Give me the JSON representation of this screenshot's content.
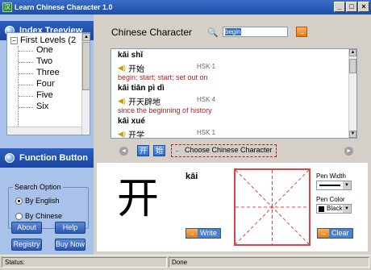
{
  "window": {
    "title": "Learn Chinese Character 1.0",
    "buttons": [
      "_",
      "□",
      "×"
    ]
  },
  "sidebar": {
    "tree_header": "Index Treeview",
    "tree": {
      "root": "First Levels (2",
      "children": [
        "One",
        "Two",
        "Three",
        "Four",
        "Five",
        "Six"
      ]
    },
    "function_header": "Function Button",
    "search_option": {
      "legend": "Search Option",
      "options": [
        {
          "label": "By English",
          "selected": true
        },
        {
          "label": "By Chinese",
          "selected": false
        }
      ]
    },
    "buttons": {
      "about": "About",
      "help": "Help",
      "registry": "Registry",
      "buy_now": "Buy Now"
    }
  },
  "main": {
    "title": "Chinese Character",
    "search_value": "begin",
    "go_label": "→",
    "entries": [
      {
        "pinyin": "kāi shǐ",
        "hanzi": "开始",
        "hsk": "HSK 1",
        "meaning": "begin; start; start; set out on"
      },
      {
        "pinyin": "kāi tiān pì dì",
        "hanzi": "开天辟地",
        "hsk": "HSK 4",
        "meaning": "since the beginning of history"
      },
      {
        "pinyin": "kāi xué",
        "hanzi": "开学",
        "hsk": "HSK 1",
        "meaning": ""
      }
    ],
    "nav": {
      "prev": "◄",
      "next": "►",
      "char1": "开",
      "char2": "始",
      "choose_label": "Choose Chinese Character",
      "choose_icon": "←"
    },
    "practice": {
      "character": "开",
      "pinyin": "kāi",
      "write_label": "Write",
      "clear_label": "Clear",
      "pen_width_label": "Pen Width",
      "pen_color_label": "Pen Color",
      "pen_color_value": "Black"
    }
  },
  "status": {
    "label": "Status:",
    "state": "Done"
  },
  "colors": {
    "title_blue": "#1d4fa8",
    "sidebar_bg": "#a9c2ea",
    "meaning_red": "#b22222",
    "grid_red": "#dd4444"
  }
}
